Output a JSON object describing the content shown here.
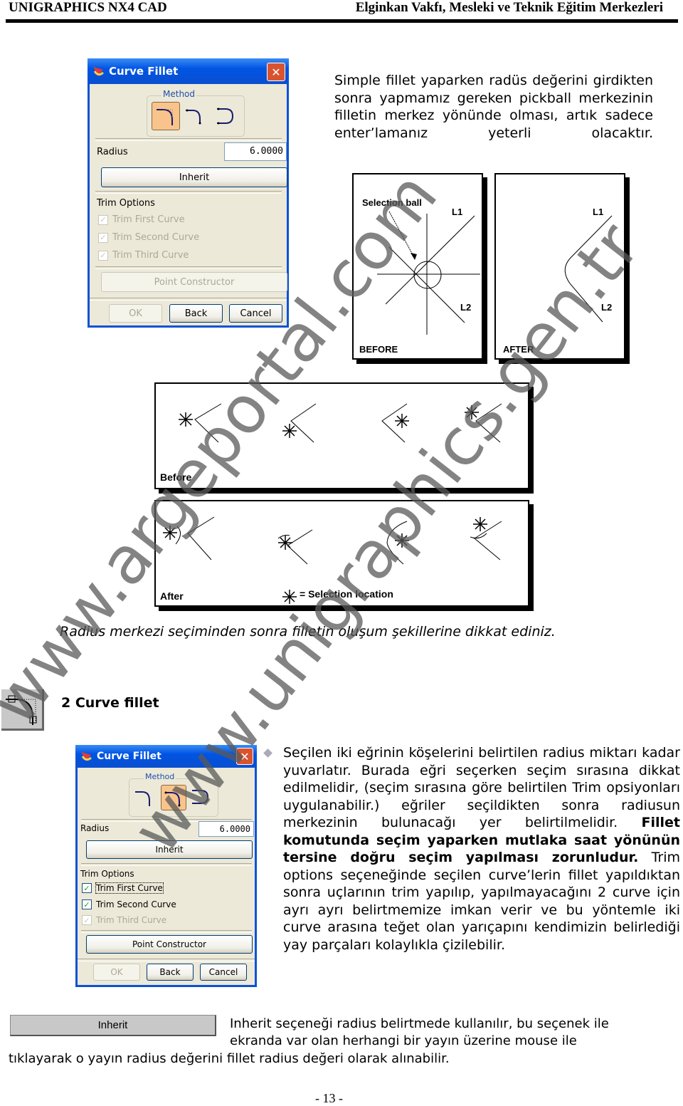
{
  "header": {
    "left": "UNIGRAPHICS NX4 CAD",
    "right": "Elginkan Vakfı, Mesleki ve Teknik Eğitim Merkezleri"
  },
  "dialog1": {
    "title": "Curve Fillet",
    "method_label": "Method",
    "method_selected": 1,
    "radius_label": "Radius",
    "radius_value": "6.0000",
    "inherit": "Inherit",
    "trim_options_label": "Trim Options",
    "trim": [
      {
        "label": "Trim First Curve",
        "checked": true,
        "enabled": false
      },
      {
        "label": "Trim Second Curve",
        "checked": true,
        "enabled": false
      },
      {
        "label": "Trim Third Curve",
        "checked": true,
        "enabled": false
      }
    ],
    "point_constructor": "Point Constructor",
    "point_constructor_enabled": false,
    "ok": "OK",
    "back": "Back",
    "cancel": "Cancel"
  },
  "intro_paragraph": "Simple fillet yaparken radüs değerini girdikten sonra yapmamız gereken pickball merkezinin filletin merkez yönünde olması, artık sadece enter’lamanız yeterli olacaktır.",
  "figure_before_after": {
    "before": {
      "label": "BEFORE",
      "selection_ball": "Selection ball",
      "l1": "L1",
      "l2": "L2"
    },
    "after": {
      "label": "AFTER",
      "l1": "L1",
      "l2": "L2"
    }
  },
  "figure_selection": {
    "before_label": "Before",
    "after_label": "After",
    "legend": "= Selection location"
  },
  "caption": "Radius merkezi seçiminden sonra filletin oluşum şekillerine dikkat ediniz.",
  "section": {
    "title": "2 Curve fillet",
    "icon": "two-curve-fillet-icon"
  },
  "dialog2": {
    "title": "Curve Fillet",
    "method_label": "Method",
    "method_selected": 2,
    "radius_label": "Radius",
    "radius_value": "6.0000",
    "inherit": "Inherit",
    "trim_options_label": "Trim Options",
    "trim": [
      {
        "label": "Trim First Curve",
        "checked": true,
        "enabled": true
      },
      {
        "label": "Trim Second Curve",
        "checked": true,
        "enabled": true
      },
      {
        "label": "Trim Third Curve",
        "checked": true,
        "enabled": false
      }
    ],
    "point_constructor": "Point Constructor",
    "ok": "OK",
    "back": "Back",
    "cancel": "Cancel"
  },
  "body": {
    "part1": "Seçilen iki eğrinin köşelerini belirtilen radius miktarı kadar yuvarlatır. Burada eğri seçerken seçim sırasına dikkat edilmelidir, (seçim sırasına göre belirtilen Trim opsiyonları uygulanabilir.) eğriler seçildikten sonra radiusun merkezinin bulunacağı yer belirtilmelidir.",
    "bold": "Fillet komutunda seçim yaparken mutlaka saat yönünün tersine doğru seçim yapılması zorunludur.",
    "part2": "Trim options seçeneğinde seçilen curve’lerin fillet yapıldıktan sonra uçlarının trim yapılıp, yapılmayacağını 2 curve için ayrı ayrı belirtmemize imkan verir ve bu yöntemle iki curve arasına teğet olan yarıçapını kendimizin belirlediği yay parçaları kolaylıkla çizilebilir."
  },
  "inherit_section": {
    "button": "Inherit",
    "line1": "Inherit seçeneği radius belirtmede kullanılır, bu seçenek ile",
    "line2": "ekranda var olan herhangi bir yayın üzerine mouse ile",
    "line3": "tıklayarak o yayın radius değerini fillet radius değeri olarak alınabilir."
  },
  "page_number": "- 13 -",
  "watermarks": [
    "www.argeportal.com",
    "www.unigraphics.gen.tr"
  ]
}
